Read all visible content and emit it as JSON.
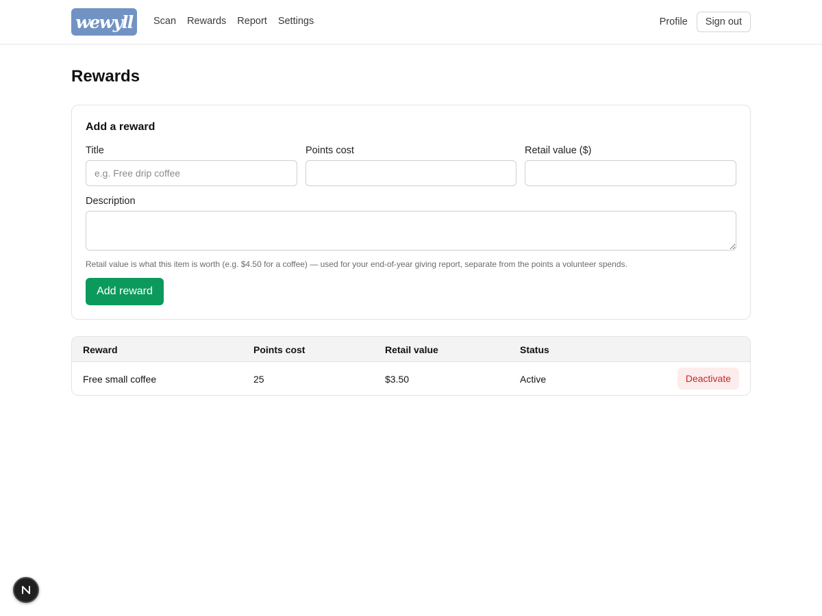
{
  "header": {
    "logo_text": "wewyll",
    "nav": [
      {
        "label": "Scan"
      },
      {
        "label": "Rewards"
      },
      {
        "label": "Report"
      },
      {
        "label": "Settings"
      }
    ],
    "profile_label": "Profile",
    "signout_label": "Sign out"
  },
  "page": {
    "title": "Rewards"
  },
  "form": {
    "heading": "Add a reward",
    "title_label": "Title",
    "title_placeholder": "e.g. Free drip coffee",
    "title_value": "",
    "points_label": "Points cost",
    "points_value": "",
    "retail_label": "Retail value ($)",
    "retail_value": "",
    "description_label": "Description",
    "description_value": "",
    "help_text": "Retail value is what this item is worth (e.g. $4.50 for a coffee) — used for your end-of-year giving report, separate from the points a volunteer spends.",
    "submit_label": "Add reward"
  },
  "table": {
    "headers": [
      "Reward",
      "Points cost",
      "Retail value",
      "Status"
    ],
    "rows": [
      {
        "reward": "Free small coffee",
        "points": "25",
        "retail": "$3.50",
        "status": "Active",
        "action": "Deactivate"
      }
    ]
  },
  "colors": {
    "accent": "#0c9a5c",
    "logo_bg": "#7193c4",
    "danger": "#c22828",
    "danger_bg": "#fdecec"
  },
  "icons": {
    "dev_badge": "nextjs-n-icon"
  }
}
